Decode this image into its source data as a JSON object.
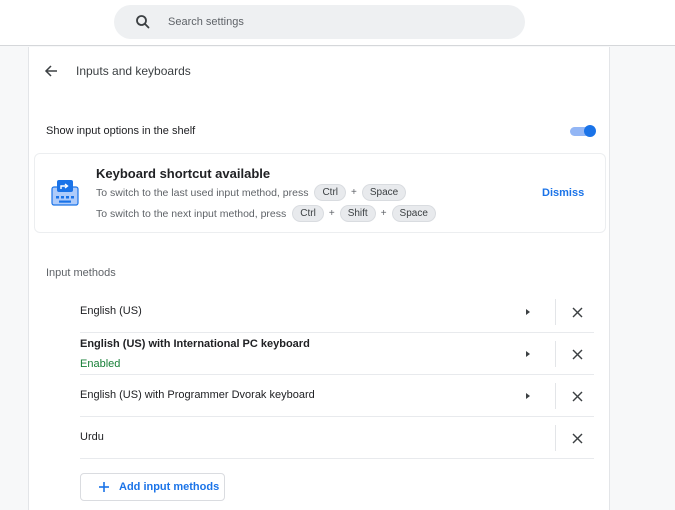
{
  "search": {
    "placeholder": "Search settings"
  },
  "page": {
    "title": "Inputs and keyboards"
  },
  "shelf": {
    "label": "Show input options in the shelf",
    "enabled": true
  },
  "shortcut_card": {
    "title": "Keyboard shortcut available",
    "line1": {
      "text": "To switch to the last used input method, press",
      "keys": [
        "Ctrl",
        "Space"
      ]
    },
    "line2": {
      "text": "To switch to the next input method, press",
      "keys": [
        "Ctrl",
        "Shift",
        "Space"
      ]
    },
    "plus": "+",
    "dismiss": "Dismiss"
  },
  "input_methods": {
    "label": "Input methods",
    "items": [
      {
        "name": "English (US)",
        "status": "",
        "has_arrow": true
      },
      {
        "name": "English (US) with International PC keyboard",
        "status": "Enabled",
        "has_arrow": true
      },
      {
        "name": "English (US) with Programmer Dvorak keyboard",
        "status": "",
        "has_arrow": true
      },
      {
        "name": "Urdu",
        "status": "",
        "has_arrow": false
      }
    ],
    "add_label": "Add input methods"
  },
  "colors": {
    "accent": "#1a73e8",
    "enabled": "#188038",
    "toggle_track": "#93b6f5"
  },
  "icons": {
    "search": "search-icon",
    "back": "arrow-back-icon",
    "keyboard": "keyboard-switch-icon",
    "arrow": "arrow-right-icon",
    "close": "close-icon",
    "add": "plus-icon"
  }
}
